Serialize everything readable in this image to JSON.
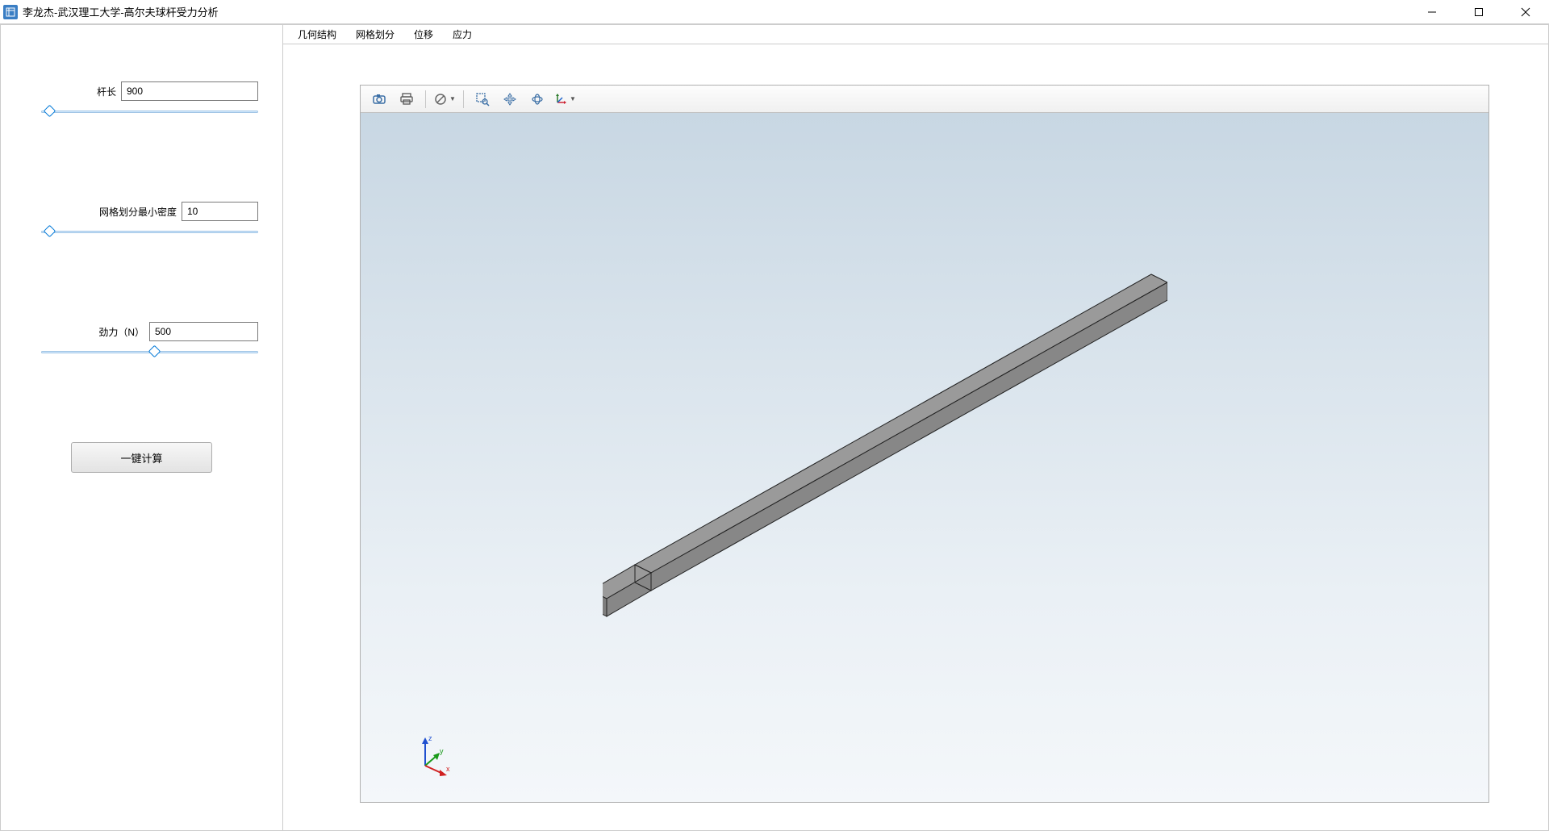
{
  "window": {
    "title": "李龙杰-武汉理工大学-高尔夫球杆受力分析"
  },
  "sidebar": {
    "params": [
      {
        "label": "杆长",
        "value": "900",
        "slider_percent": 2
      },
      {
        "label": "网格划分最小密度",
        "value": "10",
        "slider_percent": 2
      },
      {
        "label": "劲力（N）",
        "value": "500",
        "slider_percent": 50
      }
    ],
    "calc_button": "一键计算"
  },
  "tabs": [
    "几何结构",
    "网格划分",
    "位移",
    "应力"
  ],
  "toolbar_icons": {
    "camera": "camera-icon",
    "print": "print-icon",
    "forbidden": "no-symbol-icon",
    "zoom_box": "zoom-box-icon",
    "pan": "pan-icon",
    "rotate": "rotate-icon",
    "axes": "axes-icon"
  },
  "triad": {
    "x": "x",
    "y": "y",
    "z": "z"
  }
}
